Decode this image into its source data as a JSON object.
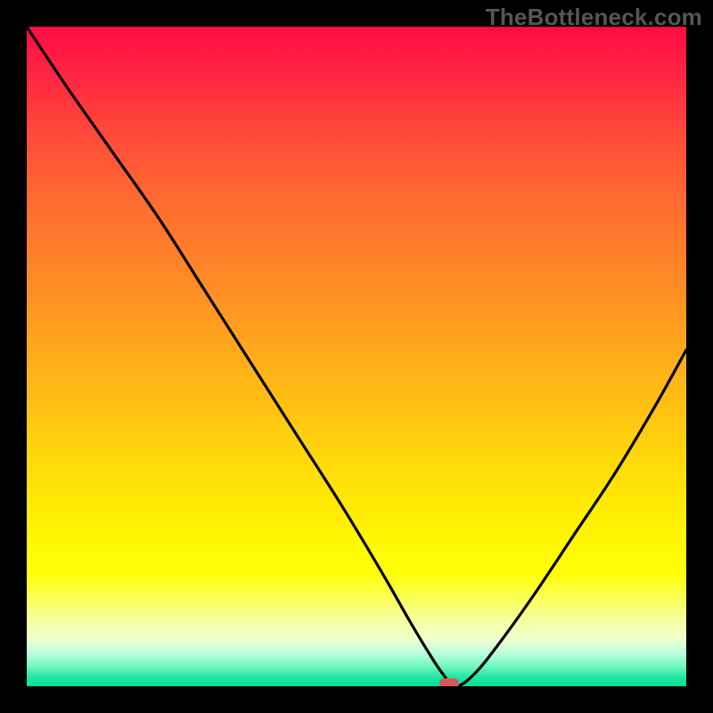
{
  "watermark": "TheBottleneck.com",
  "colors": {
    "frame": "#000000",
    "gradient_top": "#ff0a44",
    "gradient_mid": "#ffd40c",
    "gradient_bottom": "#00de98",
    "curve": "#000000",
    "minpoint": "#d35a5a"
  },
  "chart_data": {
    "type": "line",
    "title": "",
    "xlabel": "",
    "ylabel": "",
    "xlim": [
      0,
      100
    ],
    "ylim": [
      0,
      100
    ],
    "grid": false,
    "legend": false,
    "series": [
      {
        "name": "bottleneck-curve",
        "x": [
          0,
          6,
          13,
          20,
          27,
          34,
          41,
          48,
          54,
          58,
          61,
          63,
          65,
          68,
          72,
          77,
          83,
          89,
          95,
          100
        ],
        "values": [
          100,
          91,
          81,
          71,
          60,
          49,
          38,
          27,
          17,
          10,
          5,
          2,
          0,
          2,
          7,
          14,
          23,
          32,
          42,
          51
        ]
      }
    ],
    "minimum": {
      "x": 64,
      "y": 0
    },
    "annotations": []
  }
}
